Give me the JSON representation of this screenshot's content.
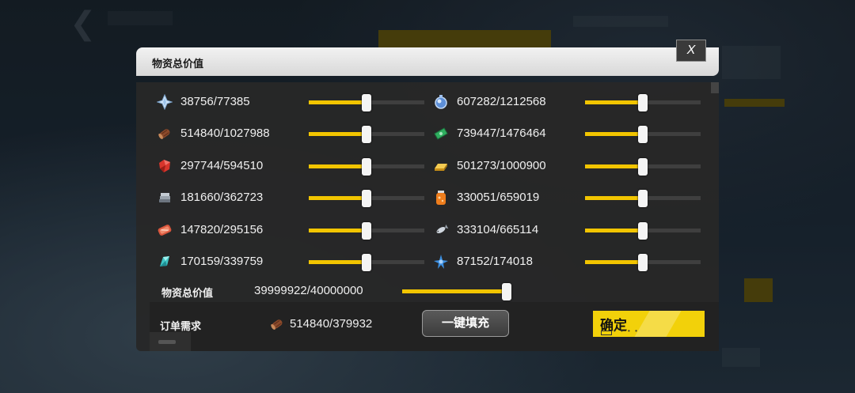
{
  "dialog": {
    "title": "物资总价值",
    "close_label": "X"
  },
  "resources": [
    {
      "icon": "crystal-icon",
      "value": "38756/77385",
      "fill": 0.5,
      "color": "#b9d6f2"
    },
    {
      "icon": "blue-orb-icon",
      "value": "607282/1212568",
      "fill": 0.5,
      "color": "#6fa8e6"
    },
    {
      "icon": "wood-log-icon",
      "value": "514840/1027988",
      "fill": 0.5,
      "color": "#8b4a2b"
    },
    {
      "icon": "green-cash-icon",
      "value": "739447/1476464",
      "fill": 0.5,
      "color": "#2fae5f"
    },
    {
      "icon": "red-gem-icon",
      "value": "297744/594510",
      "fill": 0.5,
      "color": "#d8352c"
    },
    {
      "icon": "gold-bar-icon",
      "value": "501273/1000900",
      "fill": 0.5,
      "color": "#e8b230"
    },
    {
      "icon": "metal-stack-icon",
      "value": "181660/362723",
      "fill": 0.5,
      "color": "#9aa3ad"
    },
    {
      "icon": "jar-icon",
      "value": "330051/659019",
      "fill": 0.5,
      "color": "#ee7d1c"
    },
    {
      "icon": "meat-icon",
      "value": "147820/295156",
      "fill": 0.5,
      "color": "#d8563d"
    },
    {
      "icon": "fish-icon",
      "value": "333104/665114",
      "fill": 0.5,
      "color": "#cfd6de"
    },
    {
      "icon": "teal-crystal-icon",
      "value": "170159/339759",
      "fill": 0.5,
      "color": "#3fc4c4"
    },
    {
      "icon": "blue-flower-icon",
      "value": "87152/174018",
      "fill": 0.5,
      "color": "#3b8ee0"
    }
  ],
  "total": {
    "label": "物资总价值",
    "value": "39999922/40000000",
    "fill": 0.99998
  },
  "order": {
    "label": "订单需求",
    "icon": "wood-log-icon",
    "value": "514840/379932"
  },
  "buttons": {
    "fill_all": "一键填充",
    "confirm": "确定"
  },
  "colors": {
    "accent": "#f2c500",
    "panel": "#282828",
    "header": "#e6e6e6"
  }
}
